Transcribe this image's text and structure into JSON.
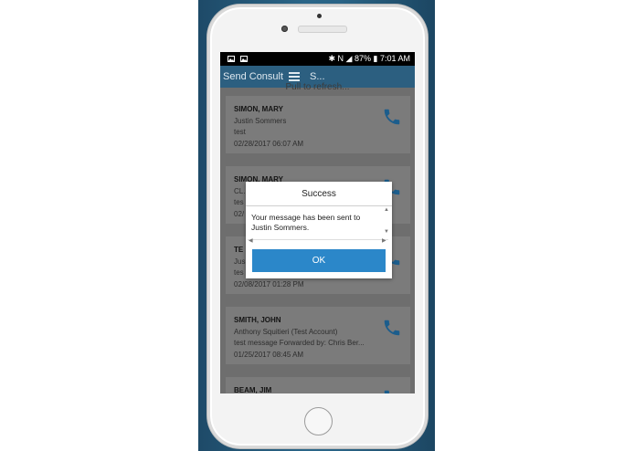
{
  "status_bar": {
    "left_icons": [
      "image-icon",
      "image-icon"
    ],
    "battery": "87%",
    "time": "7:01 AM"
  },
  "app_bar": {
    "title": "Send Consult",
    "subtitle": "S..."
  },
  "pull_to_refresh": "Pull to refresh...",
  "cards": [
    {
      "name": "SIMON, MARY",
      "from": "Justin Sommers",
      "message": "test",
      "date": "02/28/2017 06:07 AM"
    },
    {
      "name": "SIMON, MARY",
      "from": "CL...",
      "message": "tes",
      "date": "02/"
    },
    {
      "name": "TE",
      "from": "Jus",
      "message": "tes",
      "date": "02/08/2017 01:28 PM"
    },
    {
      "name": "SMITH, JOHN",
      "from": "Anthony Squitieri (Test Account)",
      "message": "test message Forwarded by: Chris Ber...",
      "date": "01/25/2017 08:45 AM"
    },
    {
      "name": "BEAM, JIM",
      "from": "",
      "message": "",
      "date": ""
    }
  ],
  "dialog": {
    "title": "Success",
    "message": "Your message has been sent to Justin Sommers.",
    "ok_label": "OK"
  },
  "colors": {
    "app_bar": "#2c5f80",
    "ok_button": "#2b87c9",
    "phone_icon": "#1c5d8c"
  }
}
